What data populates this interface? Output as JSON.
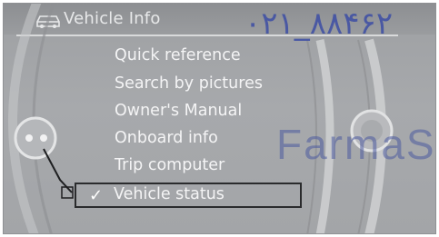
{
  "header": {
    "title": "Vehicle Info",
    "icon": "vehicle-info-icon"
  },
  "menu": {
    "items": [
      {
        "label": "Quick reference",
        "selected": false
      },
      {
        "label": "Search by pictures",
        "selected": false
      },
      {
        "label": "Owner's Manual",
        "selected": false
      },
      {
        "label": "Onboard info",
        "selected": false
      },
      {
        "label": "Trip computer",
        "selected": false
      },
      {
        "label": "Vehicle status",
        "selected": true
      }
    ],
    "selected_marker": "✓"
  },
  "watermark": {
    "phone": "۰۲۱_۸۸۴۶۲",
    "brand": "FarmaS"
  },
  "colors": {
    "screen_bg": "#a4a6a9",
    "text": "#f4f4f5",
    "selection_border": "#2a2b2d",
    "watermark": "#3d4ea5"
  }
}
